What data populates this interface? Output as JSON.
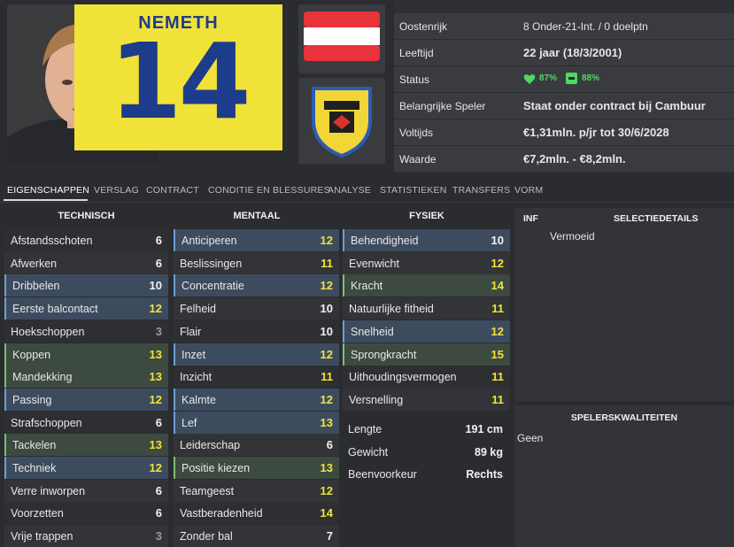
{
  "player": {
    "shirt_name": "NEMETH",
    "shirt_number": "14"
  },
  "info": [
    {
      "key": "Oostenrijk",
      "value": "8 Onder-21-Int. / 0 doelptn",
      "bold": false
    },
    {
      "key": "Leeftijd",
      "value": "22 jaar (18/3/2001)",
      "bold": true
    },
    {
      "key": "Status",
      "value": "",
      "bold": false
    },
    {
      "key": "Belangrijke Speler",
      "value": "Staat onder contract bij Cambuur",
      "bold": true
    },
    {
      "key": "Voltijds",
      "value": "€1,31mln. p/jr tot 30/6/2028",
      "bold": true
    },
    {
      "key": "Waarde",
      "value": "€7,2mln. - €8,2mln.",
      "bold": true
    }
  ],
  "status": {
    "heart_pct": "87%",
    "minus_pct": "88%",
    "color": "#4cd964"
  },
  "tabs": [
    "EIGENSCHAPPEN",
    "VERSLAG",
    "CONTRACT",
    "CONDITIE EN BLESSURES",
    "ANALYSE",
    "STATISTIEKEN",
    "TRANSFERS",
    "VORM"
  ],
  "technisch": {
    "title": "TECHNISCH",
    "rows": [
      {
        "label": "Afstandsschoten",
        "value": "6",
        "hl": "",
        "col": "w"
      },
      {
        "label": "Afwerken",
        "value": "6",
        "hl": "",
        "col": "w"
      },
      {
        "label": "Dribbelen",
        "value": "10",
        "hl": "blue",
        "col": "w"
      },
      {
        "label": "Eerste balcontact",
        "value": "12",
        "hl": "blue",
        "col": "y"
      },
      {
        "label": "Hoekschoppen",
        "value": "3",
        "hl": "",
        "col": "g"
      },
      {
        "label": "Koppen",
        "value": "13",
        "hl": "green",
        "col": "y"
      },
      {
        "label": "Mandekking",
        "value": "13",
        "hl": "green",
        "col": "y"
      },
      {
        "label": "Passing",
        "value": "12",
        "hl": "blue",
        "col": "y"
      },
      {
        "label": "Strafschoppen",
        "value": "6",
        "hl": "",
        "col": "w"
      },
      {
        "label": "Tackelen",
        "value": "13",
        "hl": "green",
        "col": "y"
      },
      {
        "label": "Techniek",
        "value": "12",
        "hl": "blue",
        "col": "y"
      },
      {
        "label": "Verre inworpen",
        "value": "6",
        "hl": "",
        "col": "w"
      },
      {
        "label": "Voorzetten",
        "value": "6",
        "hl": "",
        "col": "w"
      },
      {
        "label": "Vrije trappen",
        "value": "3",
        "hl": "",
        "col": "g"
      }
    ]
  },
  "mentaal": {
    "title": "MENTAAL",
    "rows": [
      {
        "label": "Anticiperen",
        "value": "12",
        "hl": "blue",
        "col": "y"
      },
      {
        "label": "Beslissingen",
        "value": "11",
        "hl": "",
        "col": "y"
      },
      {
        "label": "Concentratie",
        "value": "12",
        "hl": "blue",
        "col": "y"
      },
      {
        "label": "Felheid",
        "value": "10",
        "hl": "",
        "col": "w"
      },
      {
        "label": "Flair",
        "value": "10",
        "hl": "",
        "col": "w"
      },
      {
        "label": "Inzet",
        "value": "12",
        "hl": "blue",
        "col": "y"
      },
      {
        "label": "Inzicht",
        "value": "11",
        "hl": "",
        "col": "y"
      },
      {
        "label": "Kalmte",
        "value": "12",
        "hl": "blue",
        "col": "y"
      },
      {
        "label": "Lef",
        "value": "13",
        "hl": "blue",
        "col": "y"
      },
      {
        "label": "Leiderschap",
        "value": "6",
        "hl": "",
        "col": "w"
      },
      {
        "label": "Positie kiezen",
        "value": "13",
        "hl": "green",
        "col": "y"
      },
      {
        "label": "Teamgeest",
        "value": "12",
        "hl": "",
        "col": "y"
      },
      {
        "label": "Vastberadenheid",
        "value": "14",
        "hl": "",
        "col": "y"
      },
      {
        "label": "Zonder bal",
        "value": "7",
        "hl": "",
        "col": "w"
      }
    ]
  },
  "fysiek": {
    "title": "FYSIEK",
    "rows": [
      {
        "label": "Behendigheid",
        "value": "10",
        "hl": "blue",
        "col": "w"
      },
      {
        "label": "Evenwicht",
        "value": "12",
        "hl": "",
        "col": "y"
      },
      {
        "label": "Kracht",
        "value": "14",
        "hl": "green",
        "col": "y"
      },
      {
        "label": "Natuurlijke fitheid",
        "value": "11",
        "hl": "",
        "col": "y"
      },
      {
        "label": "Snelheid",
        "value": "12",
        "hl": "blue",
        "col": "y"
      },
      {
        "label": "Sprongkracht",
        "value": "15",
        "hl": "green",
        "col": "y"
      },
      {
        "label": "Uithoudingsvermogen",
        "value": "11",
        "hl": "",
        "col": "y"
      },
      {
        "label": "Versnelling",
        "value": "11",
        "hl": "",
        "col": "y"
      }
    ]
  },
  "physical_details": [
    {
      "label": "Lengte",
      "value": "191 cm"
    },
    {
      "label": "Gewicht",
      "value": "89 kg"
    },
    {
      "label": "Beenvoorkeur",
      "value": "Rechts"
    }
  ],
  "selection": {
    "inf_label": "INF",
    "title": "SELECTIEDETAILS",
    "item": "Vermoeid"
  },
  "qualities": {
    "title": "SPELERSKWALITEITEN",
    "item": "Geen"
  },
  "colors": {
    "yellow": "#f2e33a",
    "blue_hl": "#3d4b5e",
    "green_hl": "#3c4a3f"
  }
}
